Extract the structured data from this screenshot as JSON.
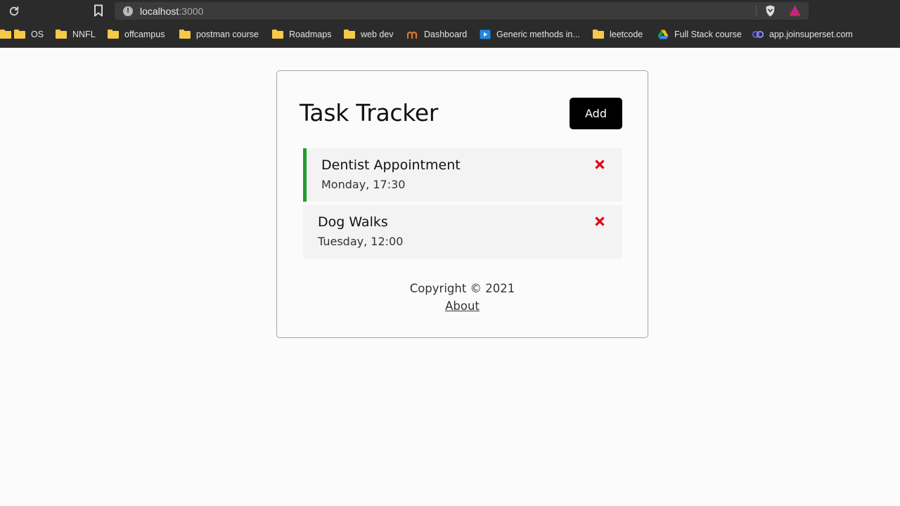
{
  "browser": {
    "url_host": "localhost",
    "url_port": ":3000",
    "icons": [
      "reload-icon",
      "bookmark-icon",
      "site-info-icon",
      "brave-shield-icon",
      "brave-rewards-icon"
    ]
  },
  "bookmarks": [
    {
      "label": "OS",
      "icon": "folder-icon"
    },
    {
      "label": "NNFL",
      "icon": "folder-icon"
    },
    {
      "label": "offcampus",
      "icon": "folder-icon"
    },
    {
      "label": "postman course",
      "icon": "folder-icon"
    },
    {
      "label": "Roadmaps",
      "icon": "folder-icon"
    },
    {
      "label": "web dev",
      "icon": "folder-icon"
    },
    {
      "label": "Dashboard",
      "icon": "app-logo-icon"
    },
    {
      "label": "Generic methods in...",
      "icon": "video-icon"
    },
    {
      "label": "leetcode",
      "icon": "folder-icon"
    },
    {
      "label": "Full Stack course",
      "icon": "drive-icon"
    },
    {
      "label": "app.joinsuperset.com",
      "icon": "superset-icon"
    }
  ],
  "app": {
    "title": "Task Tracker",
    "add_label": "Add",
    "tasks": [
      {
        "text": "Dentist Appointment",
        "day": "Monday, 17:30",
        "reminder": true
      },
      {
        "text": "Dog Walks",
        "day": "Tuesday, 12:00",
        "reminder": false
      }
    ],
    "footer": {
      "copyright": "Copyright © 2021",
      "about_label": "About"
    }
  },
  "colors": {
    "reminder_border": "#1f9e2a",
    "delete_icon": "#e00012",
    "button_bg": "#000000"
  }
}
